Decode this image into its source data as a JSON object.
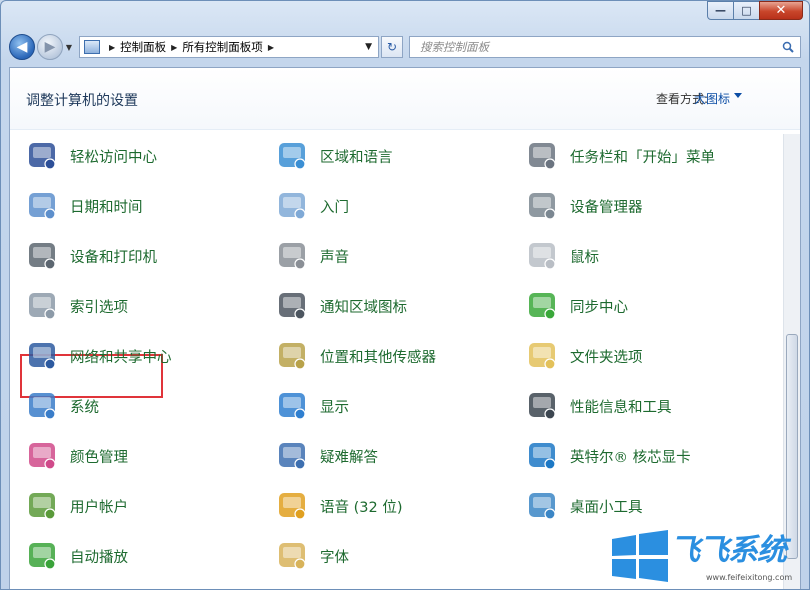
{
  "window": {
    "caption_buttons": [
      {
        "name": "minimize",
        "glyph": "—"
      },
      {
        "name": "maximize",
        "glyph": "□"
      },
      {
        "name": "close",
        "glyph": "✕"
      }
    ]
  },
  "navigation": {
    "back_glyph": "◀",
    "forward_glyph": "▶",
    "address_crumbs": [
      "控制面板",
      "所有控制面板项"
    ],
    "address_dropdown_glyph": "▼",
    "refresh_glyph": "↻",
    "search_placeholder": "搜索控制面板"
  },
  "header": {
    "title": "调整计算机的设置",
    "view_by_label": "查看方式:",
    "view_by_value": "大图标"
  },
  "items": [
    {
      "label": "轻松访问中心",
      "icon": "ease-of-access-icon",
      "color": "#2d4f98"
    },
    {
      "label": "区域和语言",
      "icon": "globe-clock-icon",
      "color": "#3b8fd4"
    },
    {
      "label": "任务栏和「开始」菜单",
      "icon": "taskbar-icon",
      "color": "#6b7480"
    },
    {
      "label": "日期和时间",
      "icon": "calendar-icon",
      "color": "#5d8fcc"
    },
    {
      "label": "入门",
      "icon": "getting-started-icon",
      "color": "#7fa9d6"
    },
    {
      "label": "设备管理器",
      "icon": "device-manager-icon",
      "color": "#7b8791"
    },
    {
      "label": "设备和打印机",
      "icon": "printer-icon",
      "color": "#5c6670"
    },
    {
      "label": "声音",
      "icon": "speaker-icon",
      "color": "#8a8f96"
    },
    {
      "label": "鼠标",
      "icon": "mouse-icon",
      "color": "#b9bec5"
    },
    {
      "label": "索引选项",
      "icon": "magnifier-icon",
      "color": "#8c9aa8"
    },
    {
      "label": "通知区域图标",
      "icon": "notification-area-icon",
      "color": "#4d5660"
    },
    {
      "label": "同步中心",
      "icon": "sync-icon",
      "color": "#3aa83a"
    },
    {
      "label": "网络和共享中心",
      "icon": "network-icon",
      "color": "#2d5aa0"
    },
    {
      "label": "位置和其他传感器",
      "icon": "sensor-icon",
      "color": "#b8a24a"
    },
    {
      "label": "文件夹选项",
      "icon": "folder-options-icon",
      "color": "#e3c15a"
    },
    {
      "label": "系统",
      "icon": "system-icon",
      "color": "#3a7dc9"
    },
    {
      "label": "显示",
      "icon": "display-icon",
      "color": "#2f7fd0"
    },
    {
      "label": "性能信息和工具",
      "icon": "performance-icon",
      "color": "#3c4650"
    },
    {
      "label": "颜色管理",
      "icon": "color-management-icon",
      "color": "#d04a8a"
    },
    {
      "label": "疑难解答",
      "icon": "troubleshooting-icon",
      "color": "#3d6fb0"
    },
    {
      "label": "英特尔® 核芯显卡",
      "icon": "intel-graphics-icon",
      "color": "#1d78c5"
    },
    {
      "label": "用户帐户",
      "icon": "user-accounts-icon",
      "color": "#5a9a3a"
    },
    {
      "label": "语音 (32 位)",
      "icon": "speech-icon",
      "color": "#e0a020"
    },
    {
      "label": "桌面小工具",
      "icon": "gadgets-icon",
      "color": "#3b86c6"
    },
    {
      "label": "自动播放",
      "icon": "autoplay-icon",
      "color": "#3aa33a"
    },
    {
      "label": "字体",
      "icon": "fonts-icon",
      "color": "#d8b35a"
    }
  ],
  "watermark": {
    "name": "飞飞系统",
    "url": "www.feifeixitong.com",
    "color": "#2b8fe0"
  }
}
